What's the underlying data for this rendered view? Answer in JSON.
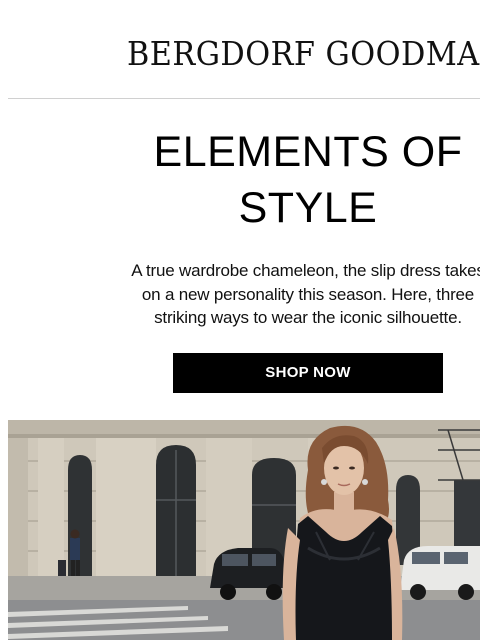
{
  "brand": {
    "logo_text": "BERGDORF GOODMAN"
  },
  "hero_section": {
    "headline": [
      "ELEMENTS OF",
      "STYLE"
    ],
    "intro_lines": [
      "A true wardrobe chameleon, the slip dress takes",
      "on a new personality this season. Here, three",
      "striking ways to wear the iconic silhouette."
    ],
    "cta_label": "SHOP NOW"
  },
  "photo": {
    "subject": "model-in-black-slip-dress",
    "colors": {
      "building": "#cfc8ba",
      "window": "#2c2f31",
      "street": "#8d8e90",
      "dress": "#15171b",
      "hair": "#8a5a3c",
      "skin": "#d9b49b"
    }
  },
  "colors": {
    "button_bg": "#000000",
    "button_text": "#ffffff",
    "divider": "#d0d0d0"
  }
}
